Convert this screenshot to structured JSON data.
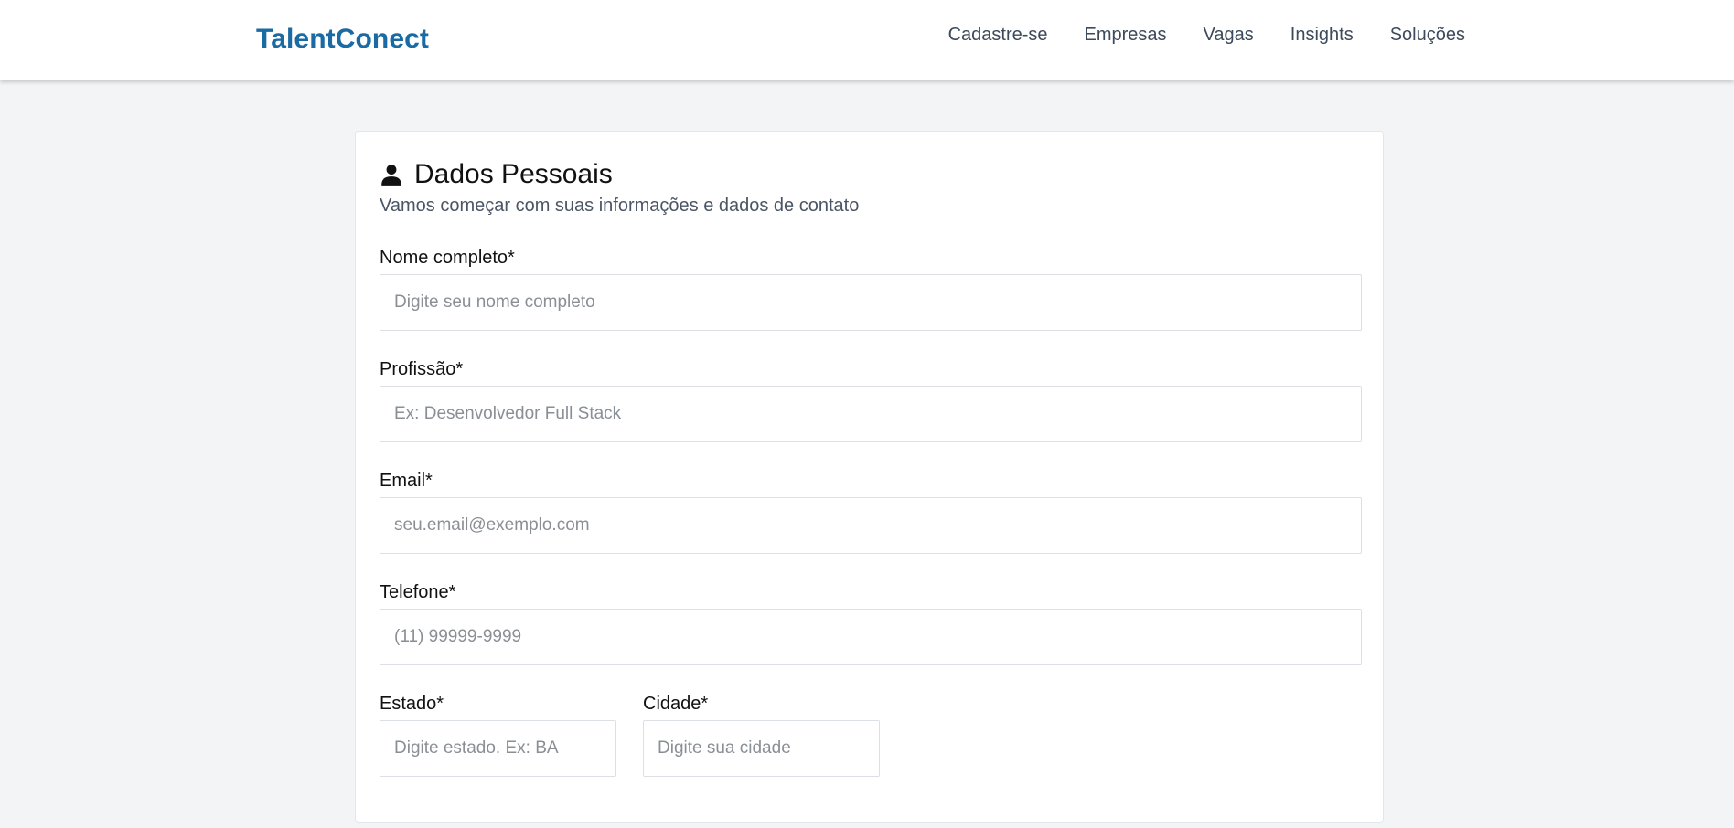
{
  "header": {
    "brand": "TalentConect",
    "nav": [
      "Cadastre-se",
      "Empresas",
      "Vagas",
      "Insights",
      "Soluções"
    ]
  },
  "section": {
    "icon": "user-icon",
    "title": "Dados Pessoais",
    "subtitle": "Vamos começar com suas informações e dados de contato"
  },
  "form": {
    "nome": {
      "label": "Nome completo*",
      "placeholder": "Digite seu nome completo",
      "value": ""
    },
    "profissao": {
      "label": "Profissão*",
      "placeholder": "Ex: Desenvolvedor Full Stack",
      "value": ""
    },
    "email": {
      "label": "Email*",
      "placeholder": "seu.email@exemplo.com",
      "value": ""
    },
    "telefone": {
      "label": "Telefone*",
      "placeholder": "(11) 99999-9999",
      "value": ""
    },
    "estado": {
      "label": "Estado*",
      "placeholder": "Digite estado. Ex: BA",
      "value": ""
    },
    "cidade": {
      "label": "Cidade*",
      "placeholder": "Digite sua cidade",
      "value": ""
    }
  },
  "colors": {
    "brand": "#1a6aa3",
    "background": "#f3f4f6",
    "nav_text": "#3d4a5c"
  }
}
